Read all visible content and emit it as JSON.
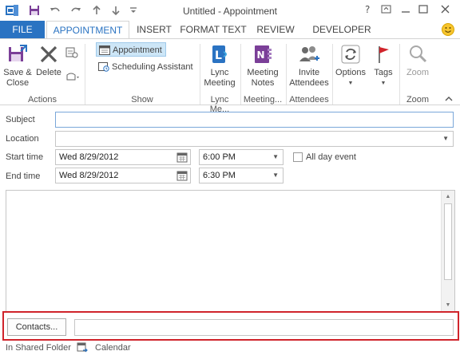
{
  "window": {
    "title": "Untitled - Appointment"
  },
  "tabs": {
    "file": "FILE",
    "items": [
      "APPOINTMENT",
      "INSERT",
      "FORMAT TEXT",
      "REVIEW",
      "DEVELOPER"
    ],
    "active": "APPOINTMENT"
  },
  "ribbon": {
    "actions": {
      "save_close": "Save &\nClose",
      "delete": "Delete",
      "group": "Actions"
    },
    "show": {
      "appointment": "Appointment",
      "scheduling": "Scheduling Assistant",
      "group": "Show"
    },
    "lync": {
      "button": "Lync\nMeeting",
      "group": "Lync Me..."
    },
    "meeting_notes": {
      "button": "Meeting\nNotes",
      "group": "Meeting..."
    },
    "attendees": {
      "button": "Invite\nAttendees",
      "group": "Attendees"
    },
    "options": {
      "button": "Options"
    },
    "tags": {
      "button": "Tags"
    },
    "zoom": {
      "button": "Zoom",
      "group": "Zoom"
    },
    "colors": {
      "accent": "#2a73c2",
      "selected": "#cde6f7"
    }
  },
  "form": {
    "subject_label": "Subject",
    "subject_value": "",
    "location_label": "Location",
    "location_value": "",
    "start_label": "Start time",
    "start_date": "Wed 8/29/2012",
    "start_time": "6:00 PM",
    "all_day_label": "All day event",
    "all_day_checked": false,
    "end_label": "End time",
    "end_date": "Wed 8/29/2012",
    "end_time": "6:30 PM"
  },
  "contacts": {
    "button": "Contacts...",
    "value": "",
    "highlight_color": "#d0242b"
  },
  "footer": {
    "folder_label": "In Shared Folder",
    "folder_name": "Calendar"
  }
}
